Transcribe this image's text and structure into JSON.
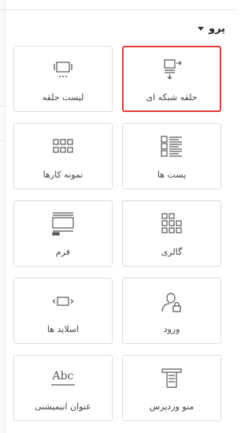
{
  "section": {
    "title": "پرو"
  },
  "widgets": [
    {
      "label": "لیست حلقه",
      "icon": "loop-list-icon",
      "selected": false
    },
    {
      "label": "حلقه شبکه ای",
      "icon": "loop-grid-icon",
      "selected": true
    },
    {
      "label": "نمونه کارها",
      "icon": "portfolio-icon",
      "selected": false
    },
    {
      "label": "پست ها",
      "icon": "posts-icon",
      "selected": false
    },
    {
      "label": "فرم",
      "icon": "form-icon",
      "selected": false
    },
    {
      "label": "گالری",
      "icon": "gallery-icon",
      "selected": false
    },
    {
      "label": "اسلاید ها",
      "icon": "slides-icon",
      "selected": false
    },
    {
      "label": "ورود",
      "icon": "login-icon",
      "selected": false
    },
    {
      "label": "عنوان انیمیشنی",
      "icon": "animated-headline-icon",
      "icon_text": "Abc",
      "selected": false
    },
    {
      "label": "منو وردپرس",
      "icon": "wordpress-menu-icon",
      "selected": false
    }
  ],
  "colors": {
    "selected_border": "#e33a3a",
    "tile_border": "#dcdcdc",
    "icon": "#555555"
  }
}
